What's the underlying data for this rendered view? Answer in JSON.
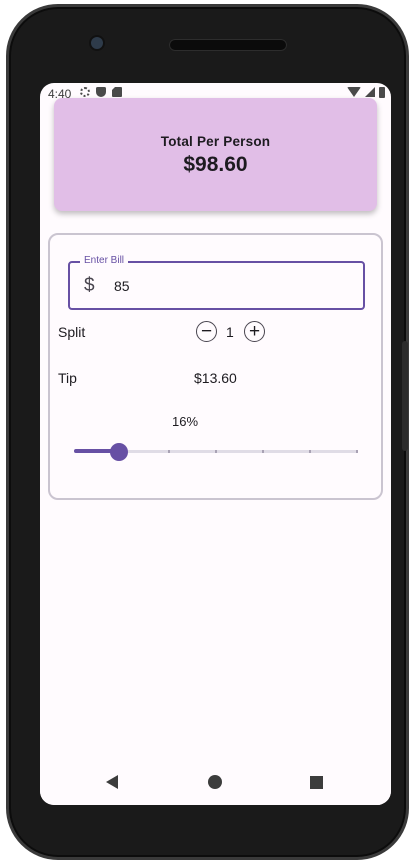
{
  "status_bar": {
    "time": "4:40",
    "left_icons": [
      "gear-icon",
      "shield-icon",
      "sd-card-icon"
    ],
    "right_icons": [
      "wifi-icon",
      "signal-icon",
      "battery-icon"
    ]
  },
  "total": {
    "label": "Total Per Person",
    "amount": "$98.60",
    "color": "#e1bee7"
  },
  "bill": {
    "label": "Enter Bill",
    "currency_symbol": "$",
    "value": "85"
  },
  "split": {
    "label": "Split",
    "count": "1",
    "minus_symbol": "−",
    "plus_symbol": "+"
  },
  "tip": {
    "label": "Tip",
    "amount": "$13.60",
    "percent_label": "16%",
    "slider_value": 0.16
  },
  "theme": {
    "accent": "#6750a4",
    "card_border": "#cac4d0"
  },
  "navbar": {
    "buttons": [
      "back-icon",
      "home-icon",
      "recents-icon"
    ]
  }
}
